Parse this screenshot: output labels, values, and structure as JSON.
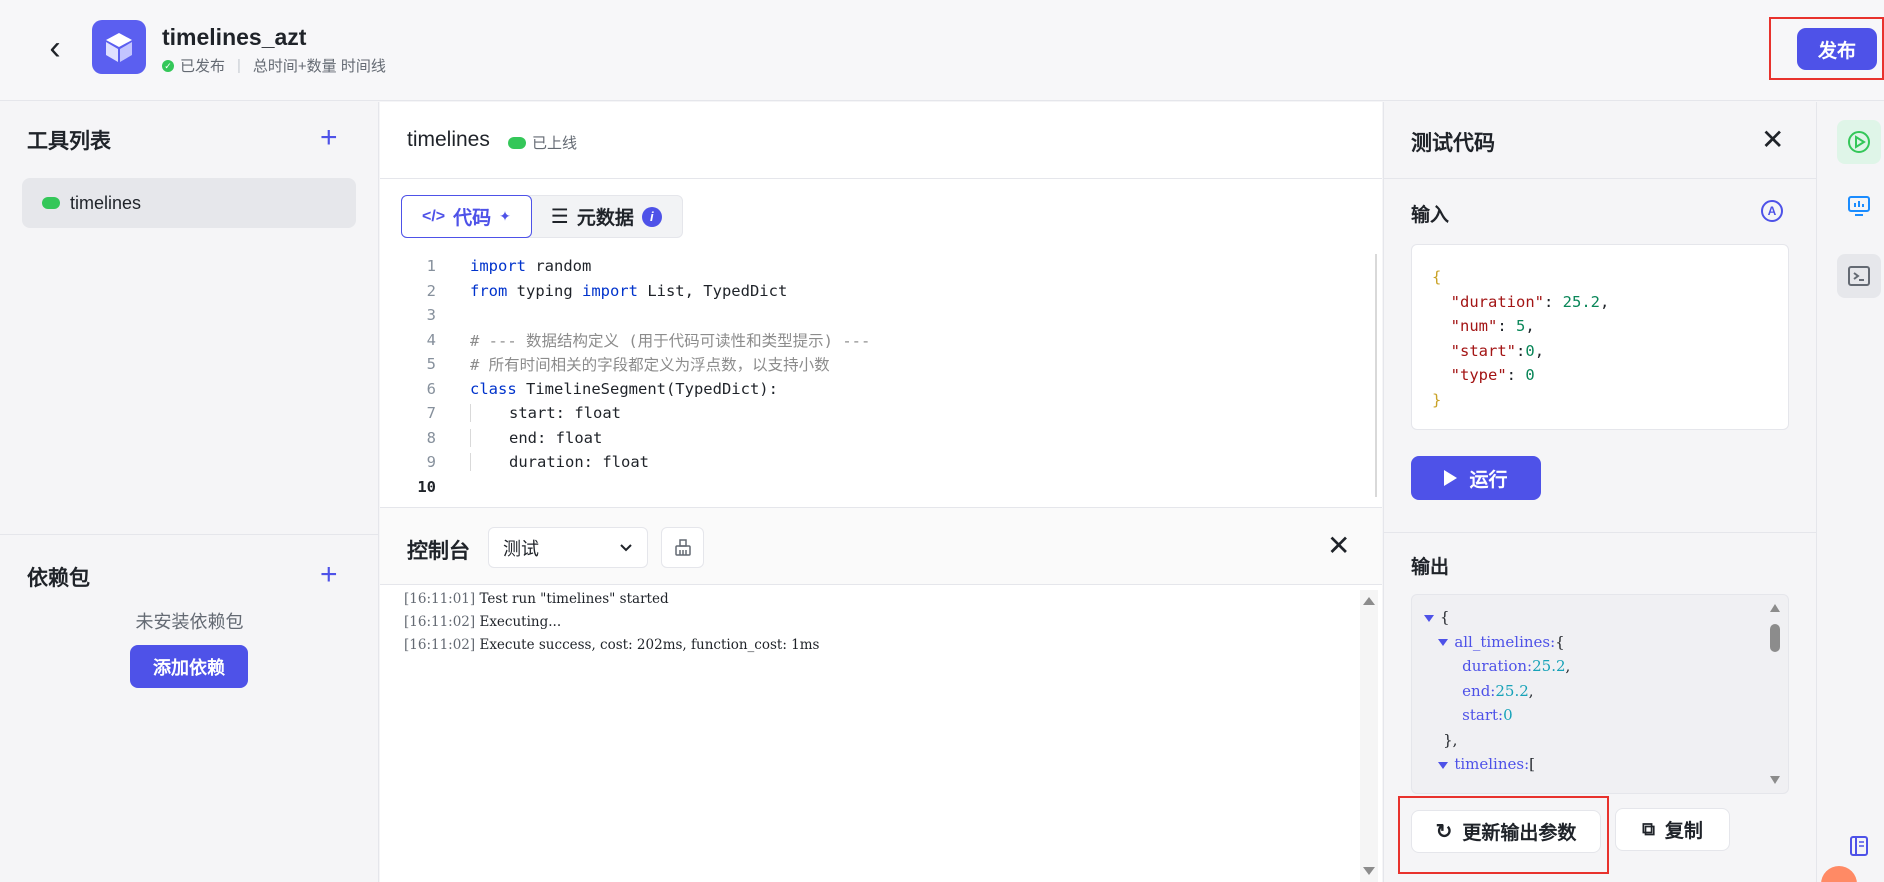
{
  "header": {
    "app_name": "timelines_azt",
    "status": "已发布",
    "description": "总时间+数量 时间线",
    "publish_label": "发布"
  },
  "sidebar": {
    "tools_title": "工具列表",
    "tools": [
      {
        "label": "timelines"
      }
    ],
    "deps_title": "依赖包",
    "deps_empty": "未安装依赖包",
    "add_dep_label": "添加依赖"
  },
  "editor": {
    "file_name": "timelines",
    "file_status": "已上线",
    "tabs": [
      {
        "label": "代码"
      },
      {
        "label": "元数据"
      }
    ],
    "info_badge": "i",
    "lines": [
      {
        "n": "1",
        "text": "import random"
      },
      {
        "n": "2",
        "text": "from typing import List, TypedDict"
      },
      {
        "n": "3",
        "text": ""
      },
      {
        "n": "4",
        "text": "# --- 数据结构定义 (用于代码可读性和类型提示) ---"
      },
      {
        "n": "5",
        "text": "# 所有时间相关的字段都定义为浮点数，以支持小数"
      },
      {
        "n": "6",
        "text": "class TimelineSegment(TypedDict):"
      },
      {
        "n": "7",
        "text": "start: float"
      },
      {
        "n": "8",
        "text": "end: float"
      },
      {
        "n": "9",
        "text": "duration: float"
      },
      {
        "n": "10",
        "text": ""
      }
    ]
  },
  "console": {
    "title": "控制台",
    "select_value": "测试",
    "logs": [
      {
        "ts": "[16:11:01]",
        "msg": " Test run \"timelines\" started"
      },
      {
        "ts": "[16:11:02]",
        "msg": " Executing..."
      },
      {
        "ts": "[16:11:02]",
        "msg": " Execute success, cost: 202ms, function_cost: 1ms"
      }
    ]
  },
  "test_panel": {
    "title": "测试代码",
    "input_label": "输入",
    "input_json": {
      "open": "{",
      "k1": "\"duration\"",
      "v1": "25.2",
      "k2": "\"num\"",
      "v2": "5",
      "k3": "\"start\"",
      "v3": "0",
      "k4": "\"type\"",
      "v4": "0",
      "close": "}"
    },
    "run_label": "运行",
    "output_label": "输出",
    "output": {
      "open": "{",
      "all_timelines_key": "all_timelines:",
      "all_timelines_open": "{",
      "duration_key": "duration:",
      "duration_val": "25.2",
      "end_key": "end:",
      "end_val": "25.2",
      "start_key": "start:",
      "start_val": "0",
      "all_timelines_close": "},",
      "timelines_key": "timelines:",
      "timelines_open": "["
    },
    "update_label": "更新输出参数",
    "copy_label": "复制"
  },
  "colors": {
    "accent": "#4e52e8",
    "success": "#34c759",
    "highlight_border": "#e8322d"
  }
}
